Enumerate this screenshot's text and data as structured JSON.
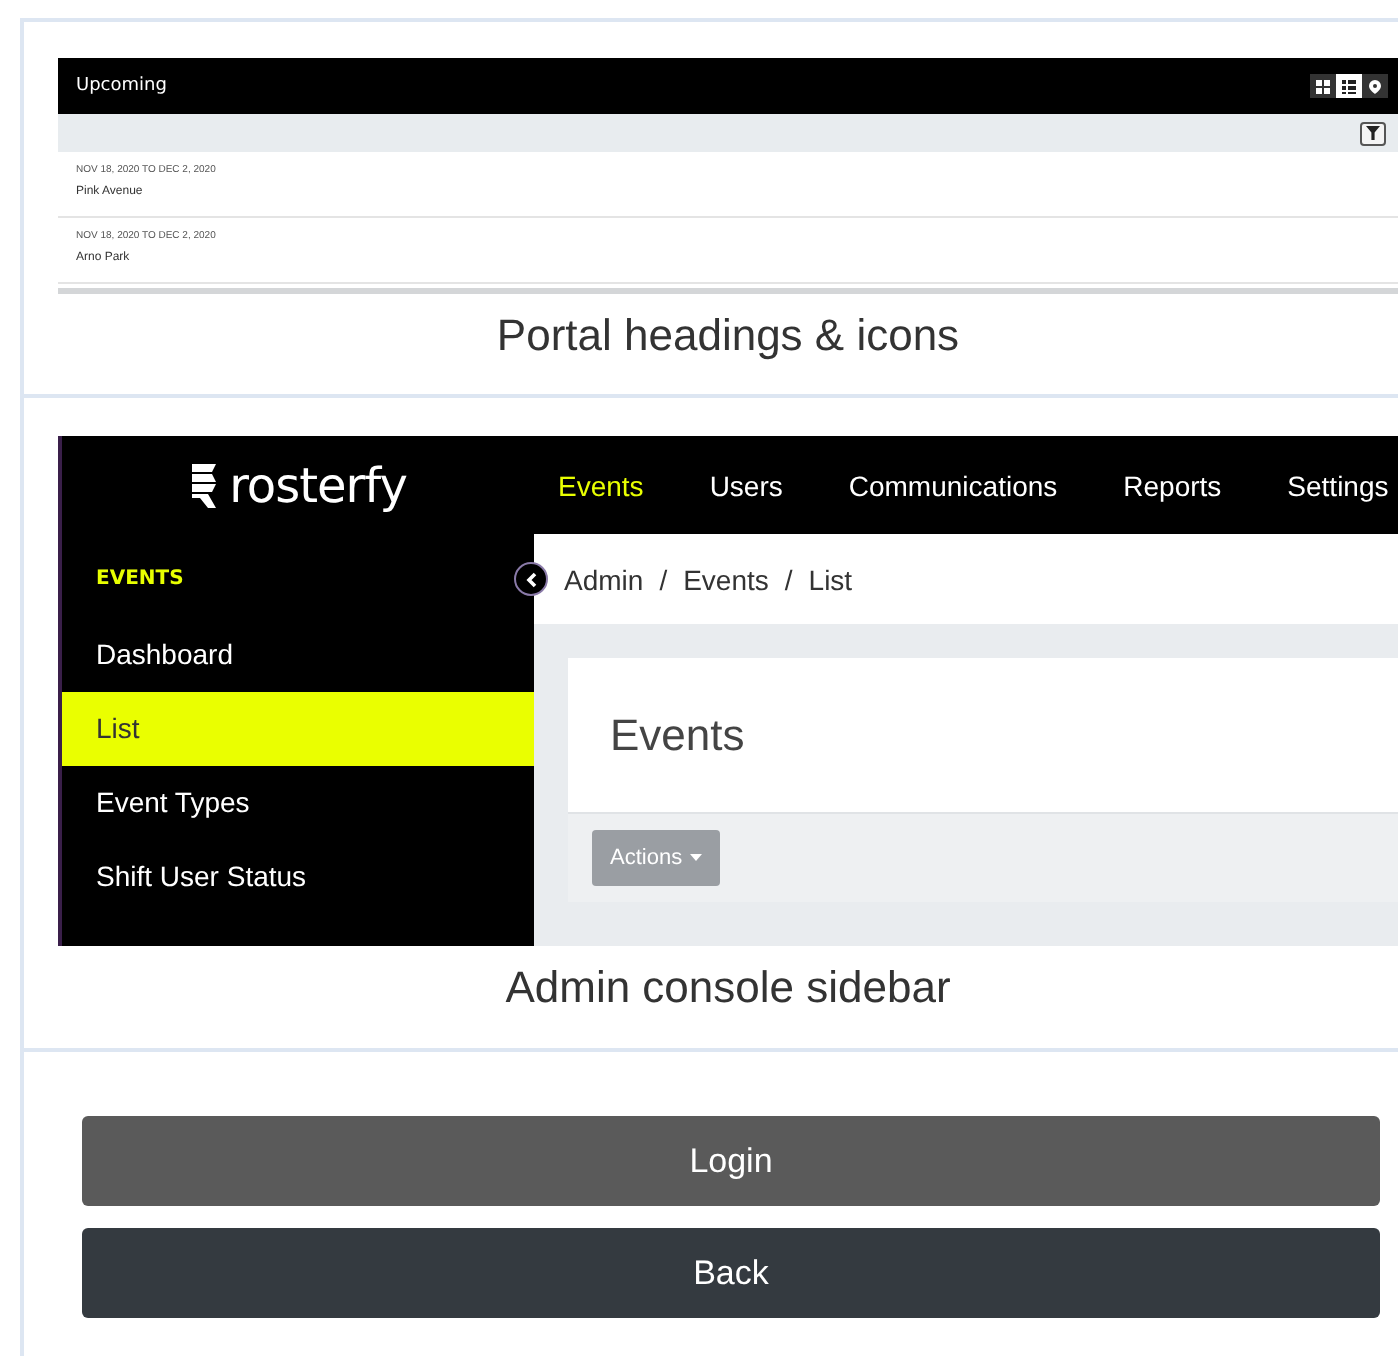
{
  "sections": [
    {
      "kind": "portal",
      "screenshot": {
        "title": "Upcoming",
        "views": [
          {
            "kind": "grid",
            "selected": false
          },
          {
            "kind": "list",
            "selected": true
          },
          {
            "kind": "pin",
            "selected": false
          }
        ],
        "events": [
          {
            "dates": "NOV 18, 2020 TO DEC 2, 2020",
            "name": "Pink Avenue"
          },
          {
            "dates": "NOV 18, 2020 TO DEC 2, 2020",
            "name": "Arno Park"
          }
        ]
      },
      "caption": "Portal headings & icons"
    },
    {
      "kind": "admin",
      "screenshot": {
        "logo": "rosterfy",
        "nav": [
          {
            "label": "Events",
            "selected": true
          },
          {
            "label": "Users",
            "selected": false
          },
          {
            "label": "Communications",
            "selected": false
          },
          {
            "label": "Reports",
            "selected": false
          },
          {
            "label": "Settings",
            "selected": false
          }
        ],
        "sidebar": {
          "heading": "EVENTS",
          "items": [
            {
              "label": "Dashboard",
              "selected": false
            },
            {
              "label": "List",
              "selected": true
            },
            {
              "label": "Event Types",
              "selected": false
            },
            {
              "label": "Shift User Status",
              "selected": false
            }
          ]
        },
        "breadcrumb": {
          "items": [
            "Admin",
            "Events",
            "List"
          ],
          "separator": "/"
        },
        "page_title": "Events",
        "actions_button": "Actions"
      },
      "caption": "Admin console sidebar"
    },
    {
      "kind": "buttons",
      "buttons": [
        {
          "label": "Login",
          "kind": "primary"
        },
        {
          "label": "Back",
          "kind": "secondary"
        }
      ]
    }
  ]
}
